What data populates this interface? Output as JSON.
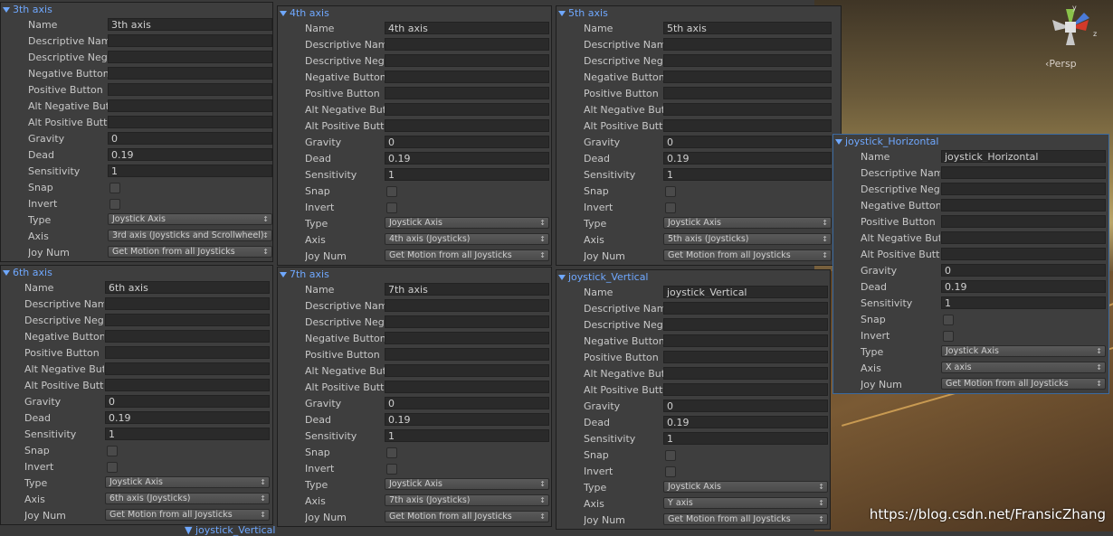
{
  "labels": {
    "name": "Name",
    "desc_pos": "Descriptive Name",
    "desc_neg": "Descriptive Negative Name",
    "neg_btn": "Negative Button",
    "pos_btn": "Positive Button",
    "alt_neg": "Alt Negative Button",
    "alt_pos": "Alt Positive Button",
    "gravity": "Gravity",
    "dead": "Dead",
    "sensitivity": "Sensitivity",
    "snap": "Snap",
    "invert": "Invert",
    "type": "Type",
    "axis": "Axis",
    "joy_num": "Joy Num"
  },
  "panels": [
    {
      "title": "3th axis",
      "name": "3th axis",
      "gravity": "0",
      "dead": "0.19",
      "sensitivity": "1",
      "type": "Joystick Axis",
      "axis": "3rd axis (Joysticks and Scrollwheel)",
      "joy": "Get Motion from all Joysticks"
    },
    {
      "title": "4th axis",
      "name": "4th axis",
      "gravity": "0",
      "dead": "0.19",
      "sensitivity": "1",
      "type": "Joystick Axis",
      "axis": "4th axis (Joysticks)",
      "joy": "Get Motion from all Joysticks"
    },
    {
      "title": "5th axis",
      "name": "5th axis",
      "gravity": "0",
      "dead": "0.19",
      "sensitivity": "1",
      "type": "Joystick Axis",
      "axis": "5th axis (Joysticks)",
      "joy": "Get Motion from all Joysticks"
    },
    {
      "title": "joystick_Horizontal",
      "name": "joystick_Horizontal",
      "gravity": "0",
      "dead": "0.19",
      "sensitivity": "1",
      "type": "Joystick Axis",
      "axis": "X axis",
      "joy": "Get Motion from all Joysticks"
    },
    {
      "title": "6th axis",
      "name": "6th axis",
      "gravity": "0",
      "dead": "0.19",
      "sensitivity": "1",
      "type": "Joystick Axis",
      "axis": "6th axis (Joysticks)",
      "joy": "Get Motion from all Joysticks"
    },
    {
      "title": "7th axis",
      "name": "7th axis",
      "gravity": "0",
      "dead": "0.19",
      "sensitivity": "1",
      "type": "Joystick Axis",
      "axis": "7th axis (Joysticks)",
      "joy": "Get Motion from all Joysticks"
    },
    {
      "title": "joystick_Vertical",
      "name": "joystick_Vertical",
      "gravity": "0",
      "dead": "0.19",
      "sensitivity": "1",
      "type": "Joystick Axis",
      "axis": "Y axis",
      "joy": "Get Motion from all Joysticks"
    }
  ],
  "stub_title": "joystick_Vertical",
  "scene": {
    "persp_label": "Persp",
    "gizmo_labels": {
      "y": "y",
      "z": "z"
    }
  },
  "watermark": "https://blog.csdn.net/FransicZhang",
  "colors": {
    "title": "#6fa8ff",
    "panel_bg": "#3e3e3e",
    "field_bg": "#2a2a2a"
  }
}
